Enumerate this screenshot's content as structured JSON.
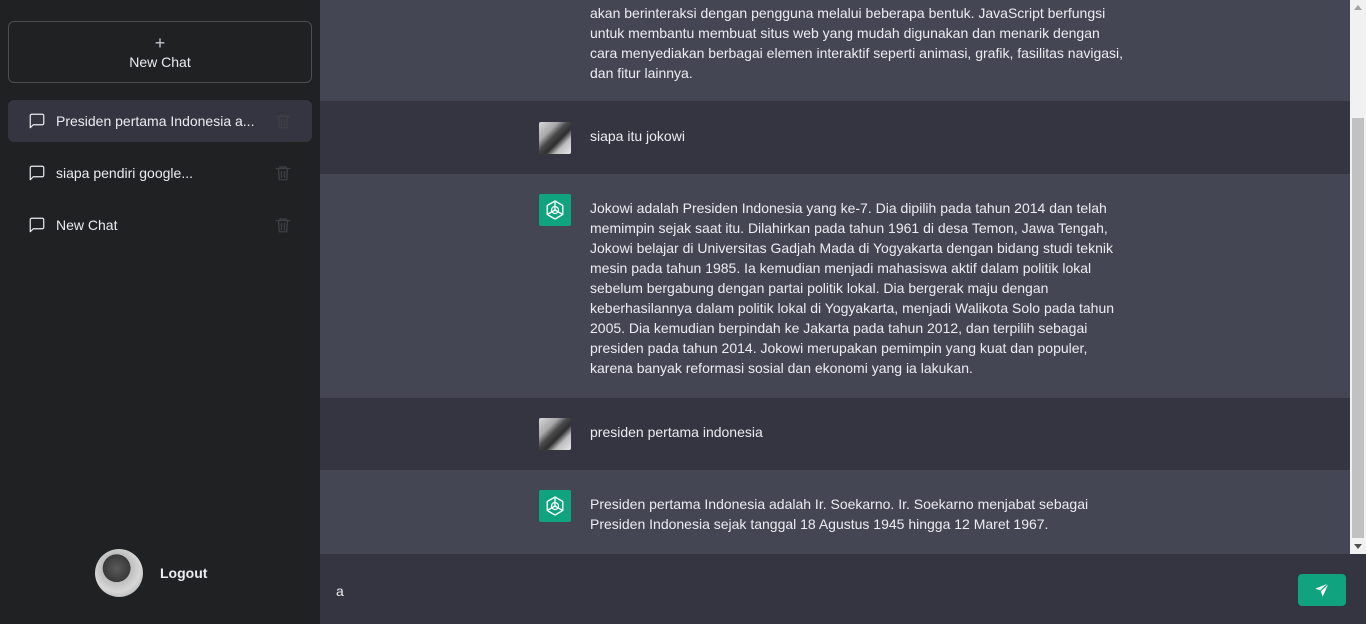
{
  "sidebar": {
    "new_chat_icon": "+",
    "new_chat_label": "New Chat",
    "history": [
      {
        "label": "Presiden pertama Indonesia a...",
        "active": true
      },
      {
        "label": "siapa pendiri google...",
        "active": false
      },
      {
        "label": "New Chat",
        "active": false
      }
    ],
    "logout_label": "Logout"
  },
  "conversation": [
    {
      "role": "bot",
      "text": "akan berinteraksi dengan pengguna melalui beberapa bentuk. JavaScript berfungsi untuk membantu membuat situs web yang mudah digunakan dan menarik dengan cara menyediakan berbagai elemen interaktif seperti animasi, grafik, fasilitas navigasi, dan fitur lainnya."
    },
    {
      "role": "user",
      "text": "siapa itu jokowi"
    },
    {
      "role": "bot",
      "text": "Jokowi adalah Presiden Indonesia yang ke-7. Dia dipilih pada tahun 2014 dan telah memimpin sejak saat itu. Dilahirkan pada tahun 1961 di desa Temon, Jawa Tengah, Jokowi belajar di Universitas Gadjah Mada di Yogyakarta dengan bidang studi teknik mesin pada tahun 1985. Ia kemudian menjadi mahasiswa aktif dalam politik lokal sebelum bergabung dengan partai politik lokal. Dia bergerak maju dengan keberhasilannya dalam politik lokal di Yogyakarta, menjadi Walikota Solo pada tahun 2005. Dia kemudian berpindah ke Jakarta pada tahun 2012, dan terpilih sebagai presiden pada tahun 2014. Jokowi merupakan pemimpin yang kuat dan populer, karena banyak reformasi sosial dan ekonomi yang ia lakukan."
    },
    {
      "role": "user",
      "text": "presiden pertama indonesia"
    },
    {
      "role": "bot",
      "text": "Presiden pertama Indonesia adalah Ir. Soekarno. Ir. Soekarno menjabat sebagai Presiden Indonesia sejak tanggal 18 Agustus 1945 hingga 12 Maret 1967."
    }
  ],
  "input": {
    "value": "a"
  },
  "colors": {
    "accent": "#10a37f",
    "sidebar": "#202123",
    "user_bg": "#343541",
    "bot_bg": "#444654"
  },
  "icons": {
    "history": "chat-bubble-icon",
    "delete": "trash-icon",
    "send": "paper-plane-icon",
    "bot": "openai-logo-icon"
  }
}
